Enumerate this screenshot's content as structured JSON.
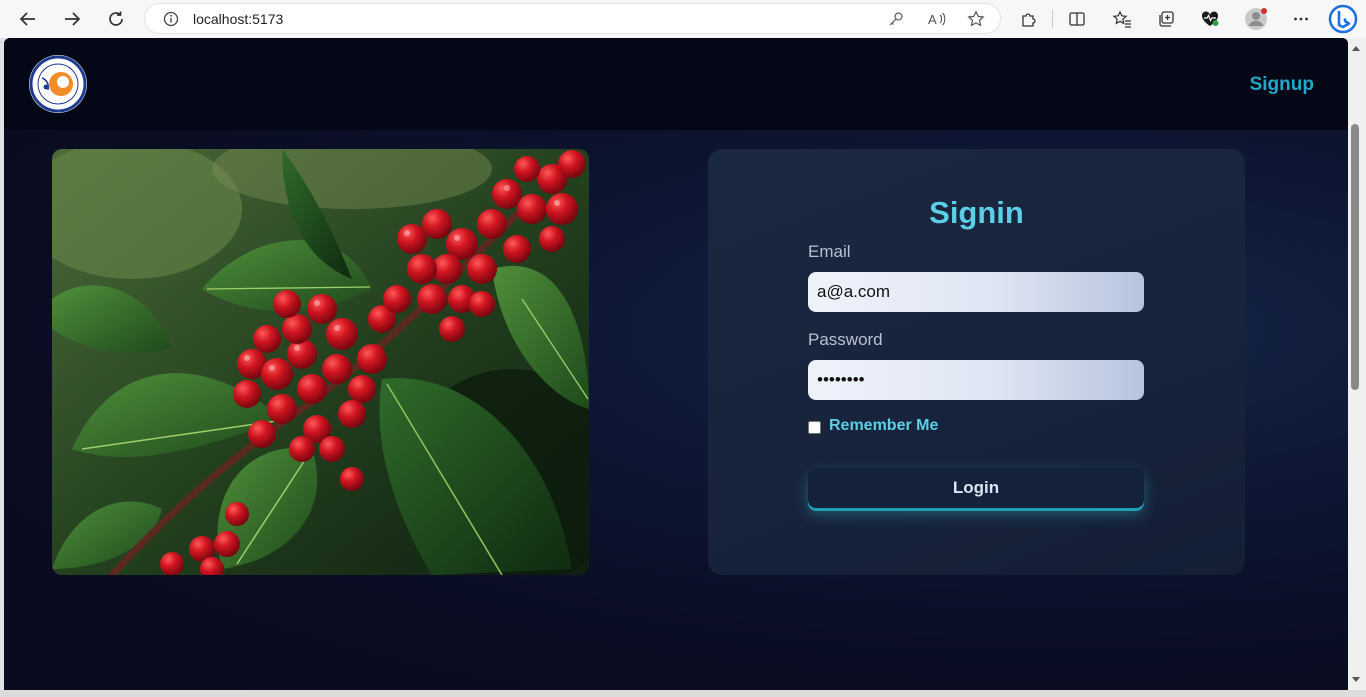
{
  "browser": {
    "url": "localhost:5173",
    "icons": [
      "back-arrow-icon",
      "forward-arrow-icon",
      "refresh-icon",
      "info-icon",
      "key-icon",
      "read-aloud-icon",
      "star-icon",
      "extensions-icon",
      "split-screen-icon",
      "favorites-icon",
      "collections-icon",
      "health-icon",
      "profile-avatar",
      "more-icon",
      "bing-icon"
    ]
  },
  "navbar": {
    "signup_label": "Signup"
  },
  "form": {
    "title": "Signin",
    "email_label": "Email",
    "email_value": "a@a.com",
    "password_label": "Password",
    "password_value": "password",
    "remember_label": "Remember Me",
    "remember_checked": false,
    "login_label": "Login"
  },
  "colors": {
    "accent": "#5ccfe6",
    "signup": "#22a7c8",
    "navbar": "#030716",
    "card": "#17233b"
  }
}
